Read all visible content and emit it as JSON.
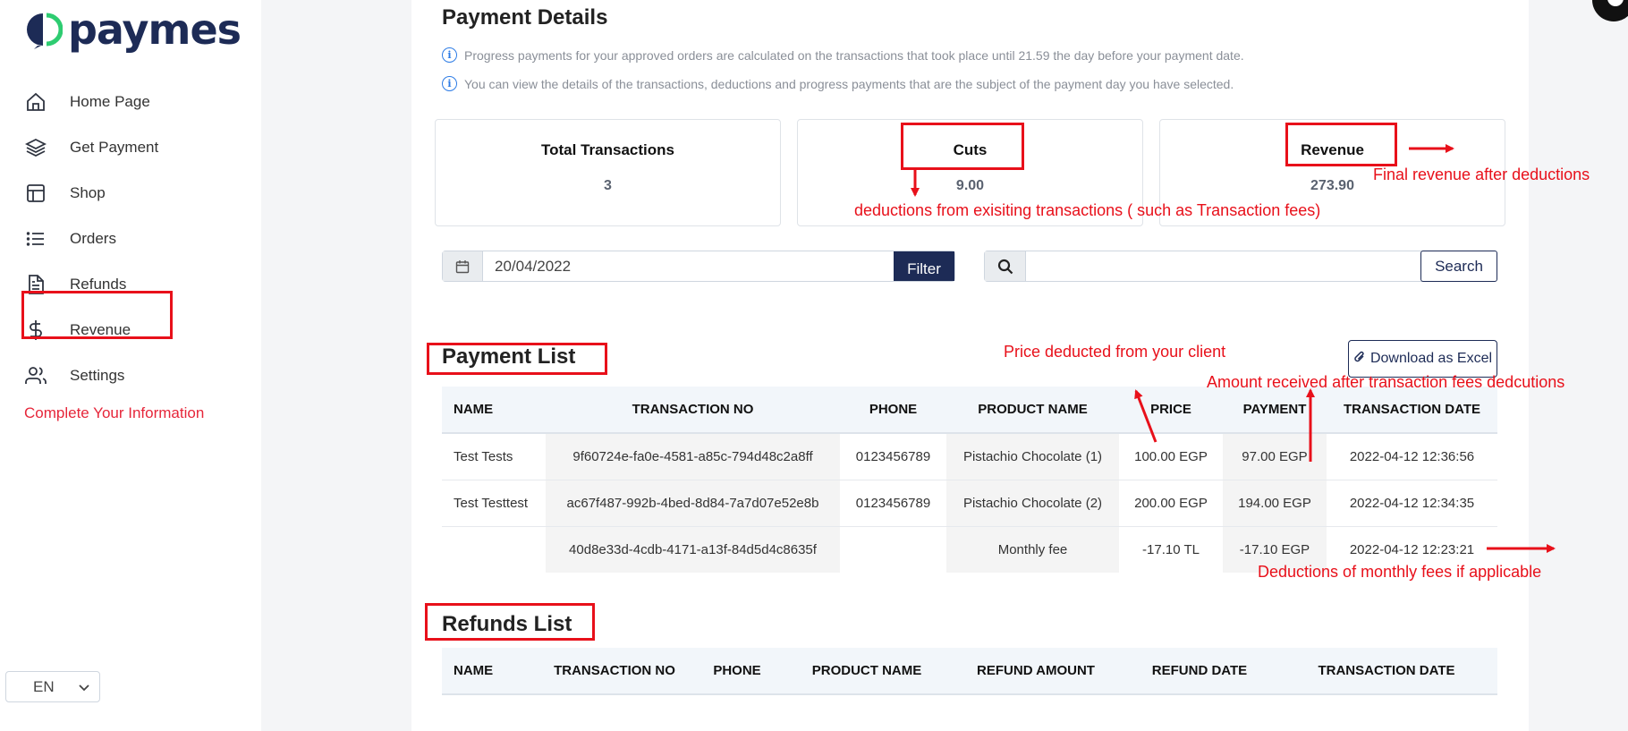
{
  "brand": {
    "name": "paymes",
    "primary": "#1d2b56",
    "accent": "#2ecc71"
  },
  "sidebar": {
    "items": [
      {
        "label": "Home Page",
        "icon": "home-icon"
      },
      {
        "label": "Get Payment",
        "icon": "layers-icon"
      },
      {
        "label": "Shop",
        "icon": "layout-icon"
      },
      {
        "label": "Orders",
        "icon": "list-icon"
      },
      {
        "label": "Refunds",
        "icon": "document-icon"
      },
      {
        "label": "Revenue",
        "icon": "dollar-icon"
      },
      {
        "label": "Settings",
        "icon": "users-icon"
      }
    ],
    "complete_info": "Complete Your Information",
    "language": "EN"
  },
  "main": {
    "title": "Payment Details",
    "info": [
      "Progress payments for your approved orders are calculated on the transactions that took place until 21.59 the day before your payment date.",
      "You can view the details of the transactions, deductions and progress payments that are the subject of the payment day you have selected."
    ],
    "stats": [
      {
        "label": "Total Transactions",
        "value": "3"
      },
      {
        "label": "Cuts",
        "value": "9.00"
      },
      {
        "label": "Revenue",
        "value": "273.90"
      }
    ],
    "date_value": "20/04/2022",
    "filter_label": "Filter",
    "search_placeholder": "",
    "search_label": "Search"
  },
  "payment_list": {
    "title": "Payment List",
    "download_label": "Download as Excel",
    "columns": [
      "NAME",
      "TRANSACTION NO",
      "PHONE",
      "PRODUCT NAME",
      "PRICE",
      "PAYMENT",
      "TRANSACTION DATE"
    ],
    "rows": [
      [
        "Test Tests",
        "9f60724e-fa0e-4581-a85c-794d48c2a8ff",
        "0123456789",
        "Pistachio Chocolate (1)",
        "100.00 EGP",
        "97.00 EGP",
        "2022-04-12 12:36:56"
      ],
      [
        "Test Testtest",
        "ac67f487-992b-4bed-8d84-7a7d07e52e8b",
        "0123456789",
        "Pistachio Chocolate (2)",
        "200.00 EGP",
        "194.00 EGP",
        "2022-04-12 12:34:35"
      ],
      [
        "",
        "40d8e33d-4cdb-4171-a13f-84d5d4c8635f",
        "",
        "Monthly fee",
        "-17.10 TL",
        "-17.10 EGP",
        "2022-04-12 12:23:21"
      ]
    ]
  },
  "refunds_list": {
    "title": "Refunds List",
    "columns": [
      "NAME",
      "TRANSACTION NO",
      "PHONE",
      "PRODUCT NAME",
      "REFUND AMOUNT",
      "REFUND DATE",
      "TRANSACTION DATE"
    ]
  },
  "annotations": {
    "color": "#e8101a",
    "final_revenue": "Final revenue after deductions",
    "deductions": "deductions from exisiting transactions ( such as Transaction fees)",
    "price_deducted": "Price deducted from your client",
    "amount_received": "Amount received after transaction fees dedcutions",
    "monthly_fees": "Deductions of monthly fees if applicable"
  }
}
